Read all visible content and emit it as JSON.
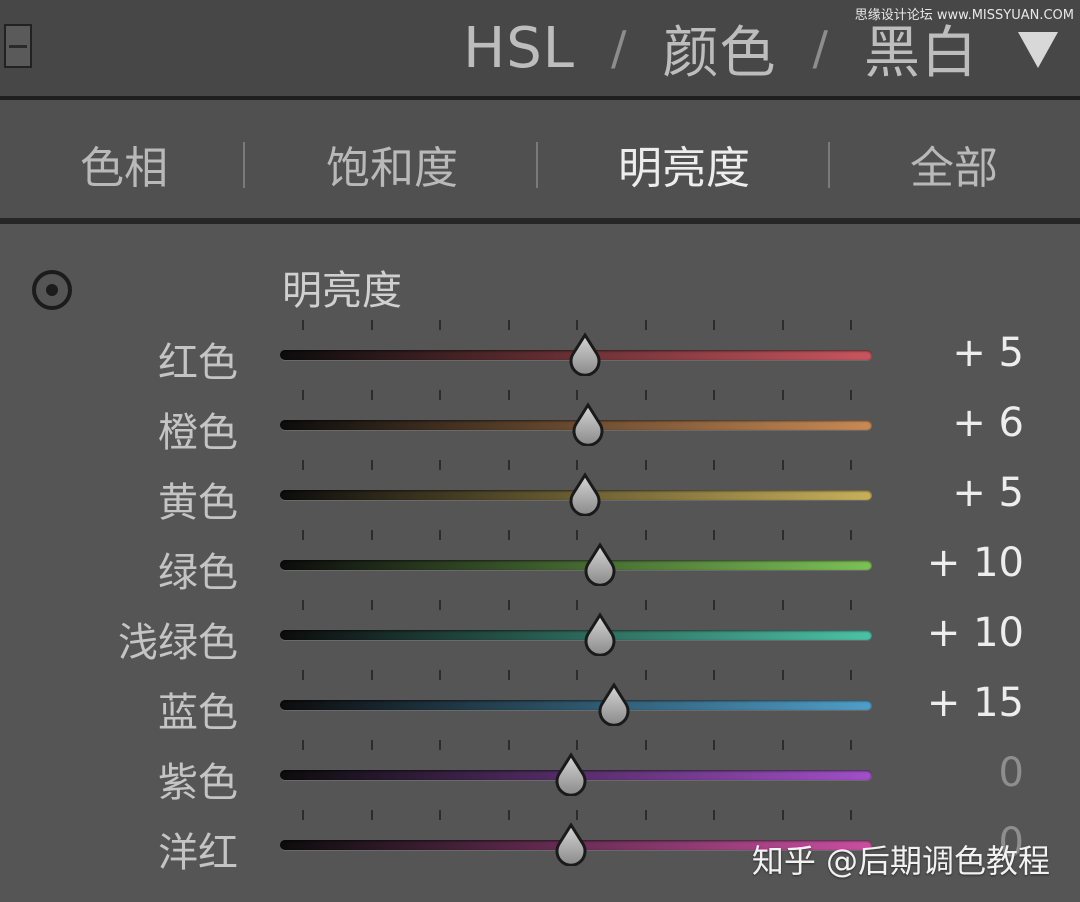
{
  "watermark_top": "思缘设计论坛 www.MISSYUAN.COM",
  "header": {
    "tabs": [
      "HSL",
      "颜色",
      "黑白"
    ],
    "separator": "/"
  },
  "subtabs": [
    "色相",
    "饱和度",
    "明亮度",
    "全部"
  ],
  "active_subtab": "明亮度",
  "section_title": "明亮度",
  "sliders": [
    {
      "label": "红色",
      "value": "+ 5",
      "amount": 5,
      "color": "#c9555e"
    },
    {
      "label": "橙色",
      "value": "+ 6",
      "amount": 6,
      "color": "#c98a55"
    },
    {
      "label": "黄色",
      "value": "+ 5",
      "amount": 5,
      "color": "#c8b05a"
    },
    {
      "label": "绿色",
      "value": "+ 10",
      "amount": 10,
      "color": "#7cc156"
    },
    {
      "label": "浅绿色",
      "value": "+ 10",
      "amount": 10,
      "color": "#4cc1a6"
    },
    {
      "label": "蓝色",
      "value": "+ 15",
      "amount": 15,
      "color": "#4f9ec9"
    },
    {
      "label": "紫色",
      "value": "0",
      "amount": 0,
      "color": "#a24fc9"
    },
    {
      "label": "洋红",
      "value": "0",
      "amount": 0,
      "color": "#c94fa0"
    }
  ],
  "watermark_bottom": "知乎 @后期调色教程"
}
